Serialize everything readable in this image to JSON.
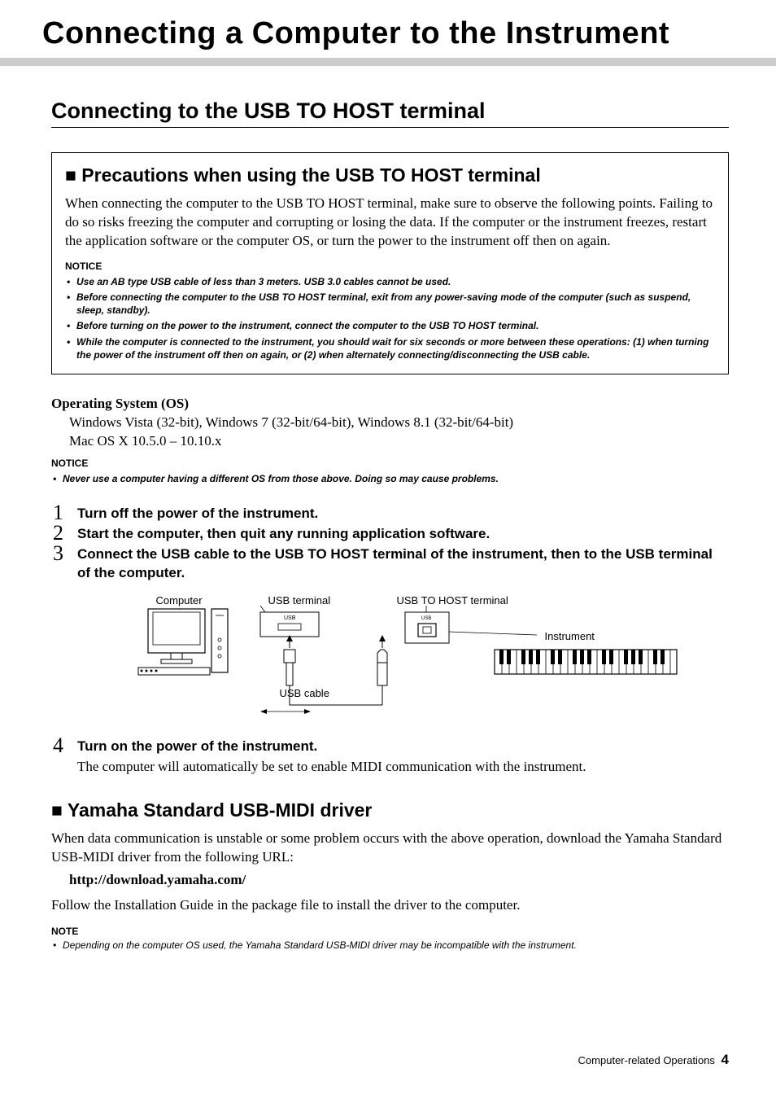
{
  "chapter_title": "Connecting a Computer to the Instrument",
  "section_title": "Connecting to the USB TO HOST terminal",
  "precautions": {
    "heading_prefix": "■ ",
    "heading": "Precautions when using the USB TO HOST terminal",
    "body": "When connecting the computer to the USB TO HOST terminal, make sure to observe the following points. Failing to do so risks freezing the computer and corrupting or losing the data. If the computer or the instrument freezes, restart the application software or the computer OS, or turn the power to the instrument off then on again.",
    "notice_label": "NOTICE",
    "notices": [
      "Use an AB type USB cable of less than 3 meters. USB 3.0 cables cannot be used.",
      "Before connecting the computer to the USB TO HOST terminal, exit from any power-saving mode of the computer (such as suspend, sleep, standby).",
      "Before turning on the power to the instrument, connect the computer to the USB TO HOST terminal.",
      "While the computer is connected to the instrument, you should wait for six seconds or more between these operations: (1) when turning the power of the instrument off then on again, or (2) when alternately connecting/disconnecting the USB cable."
    ]
  },
  "os": {
    "heading": "Operating System (OS)",
    "line1": "Windows Vista (32-bit), Windows 7 (32-bit/64-bit), Windows 8.1 (32-bit/64-bit)",
    "line2": "Mac OS X 10.5.0 – 10.10.x",
    "notice_label": "NOTICE",
    "notice": "Never use a computer having a different OS from those above. Doing so may cause problems."
  },
  "steps": [
    {
      "n": "1",
      "text": "Turn off the power of the instrument."
    },
    {
      "n": "2",
      "text": "Start the computer, then quit any running application software."
    },
    {
      "n": "3",
      "text": "Connect the USB cable to the USB TO HOST terminal of the instrument, then to the USB terminal of the computer."
    },
    {
      "n": "4",
      "text": "Turn on the power of the instrument.",
      "body": "The computer will automatically be set to enable MIDI communication with the instrument."
    }
  ],
  "diagram": {
    "computer": "Computer",
    "usb_terminal": "USB terminal",
    "usb_to_host": "USB TO HOST terminal",
    "instrument": "Instrument",
    "usb_cable": "USB cable",
    "usb_port_label": "USB"
  },
  "driver": {
    "heading_prefix": "■ ",
    "heading": "Yamaha Standard USB-MIDI driver",
    "body1": "When data communication is unstable or some problem occurs with the above operation, download the Yamaha Standard USB-MIDI driver from the following URL:",
    "url": "http://download.yamaha.com/",
    "body2": "Follow the Installation Guide in the package file to install the driver to the computer.",
    "note_label": "NOTE",
    "note": "Depending on the computer OS used, the Yamaha Standard USB-MIDI driver may be incompatible with the instrument."
  },
  "footer": {
    "doc_title": "Computer-related Operations",
    "page": "4"
  }
}
